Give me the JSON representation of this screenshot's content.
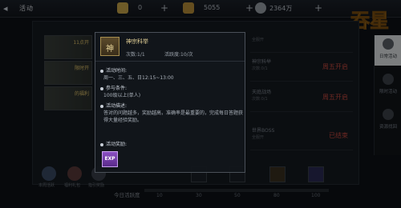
{
  "topbar": {
    "title": "活动",
    "resources": [
      {
        "icon": "ingot-icon",
        "value": "0"
      },
      {
        "icon": "gold-icon",
        "value": "5055"
      },
      {
        "icon": "coin-icon",
        "value": "2364万"
      }
    ],
    "plus": "+"
  },
  "logo": {
    "text": "吞星"
  },
  "left_cards": [
    {
      "label": "11点开"
    },
    {
      "label": "限时开"
    },
    {
      "label": "的福利"
    }
  ],
  "right_rows": [
    {
      "name": "",
      "sub": "全服开",
      "status": ""
    },
    {
      "name": "神宗科举",
      "sub": "次数:0/1",
      "status": "周五开启"
    },
    {
      "name": "天庭战场",
      "sub": "次数:0/1",
      "status": "周五开启"
    },
    {
      "name": "世界BOSS",
      "sub": "全服开",
      "status": "已结束"
    }
  ],
  "side_tabs": [
    {
      "icon": "calendar-icon",
      "label": "日常活动"
    },
    {
      "icon": "clock-icon",
      "label": "限时活动"
    },
    {
      "icon": "coin-icon",
      "label": "资源找回"
    }
  ],
  "bottom": {
    "activity_label": "今日活跃度",
    "ticks": [
      "10",
      "30",
      "50",
      "80",
      "100"
    ],
    "progress": 0.0,
    "icons": [
      {
        "icon": "ghost-icon",
        "label": "本周活跃"
      },
      {
        "icon": "lantern-icon",
        "label": "福利礼包"
      },
      {
        "icon": "guide-icon",
        "label": "指引奖励"
      }
    ]
  },
  "tooltip": {
    "icon_glyph": "神",
    "title": "神宗科举",
    "count": "次数:1/1",
    "activity": "活跃度:10/次",
    "time_heading": "活动时间:",
    "time_value": "周一、三、五、日12:15~13:00",
    "cond_heading": "参与条件:",
    "cond_value": "100级以上(单人)",
    "desc_heading": "活动描述:",
    "desc_value": "答对的问题越多，奖励越高，准确率是最重要的，完成每日答题获得大量经验奖励。",
    "reward_heading": "活动奖励:",
    "reward_badge": "EXP"
  }
}
